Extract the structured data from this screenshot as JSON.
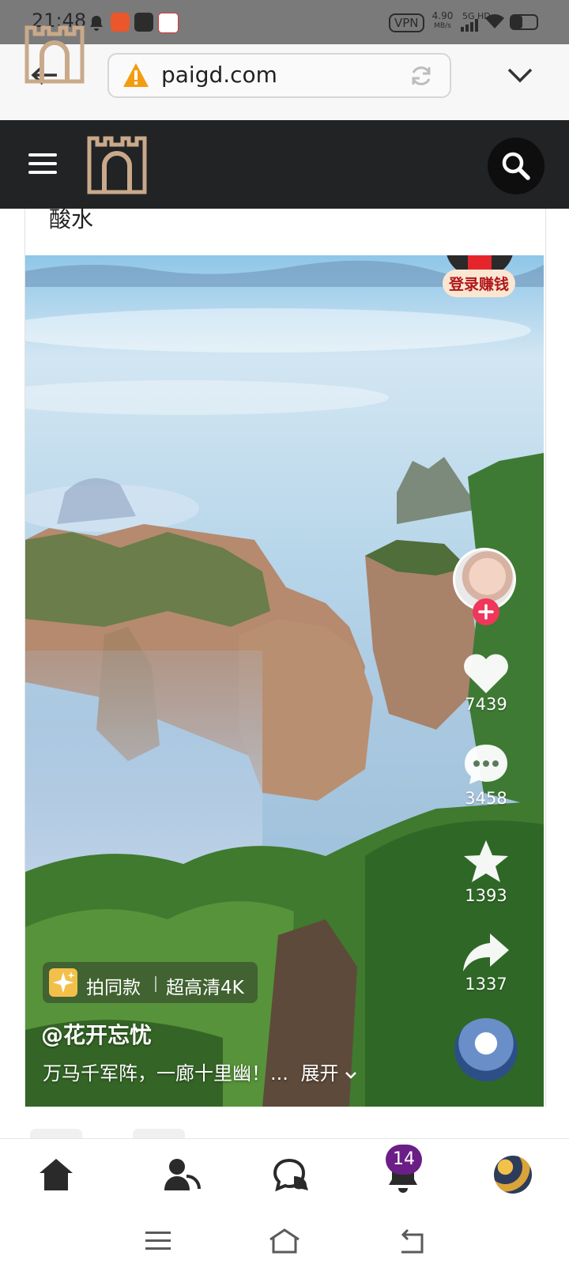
{
  "status_bar": {
    "time": "21:48",
    "vpn": "VPN",
    "speed": "4.90",
    "speed_unit": "MB/s",
    "network": "5G HD",
    "battery_level": 0.45
  },
  "browser": {
    "url": "paigd.com"
  },
  "post": {
    "title_fragment": "酸水"
  },
  "video": {
    "login_earn_label": "登录赚钱",
    "action_label": "拍同款",
    "quality_label": "超高清4K",
    "author": "@花开忘忧",
    "caption": "万马千军阵，一廊十里幽！...",
    "expand_label": "展开",
    "likes": "7439",
    "comments": "3458",
    "favorites": "1393",
    "shares": "1337"
  },
  "bottom_nav": {
    "notification_count": "14"
  },
  "colors": {
    "header_bg": "#222325",
    "badge_bg": "#6b1f86",
    "follow_red": "#f0365a",
    "logo_tan": "#c9a98a"
  }
}
